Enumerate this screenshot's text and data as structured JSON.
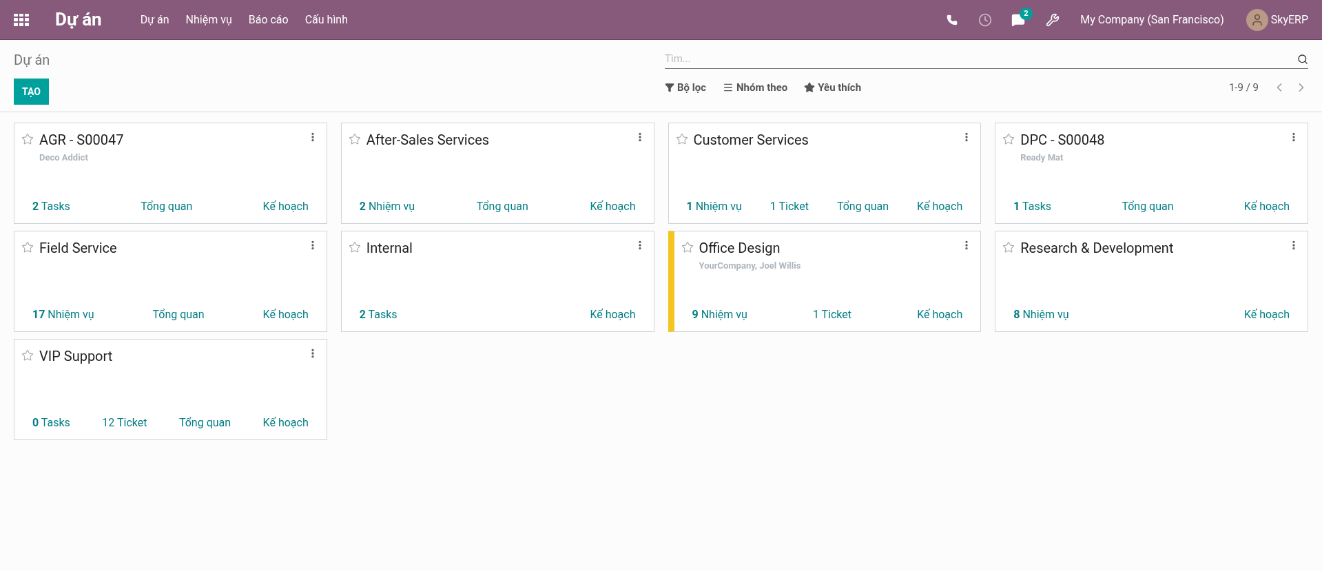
{
  "navbar": {
    "app_title": "Dự án",
    "menu": [
      "Dự án",
      "Nhiệm vụ",
      "Báo cáo",
      "Cấu hình"
    ],
    "message_count": "2",
    "company": "My Company (San Francisco)",
    "user": "SkyERP"
  },
  "control_panel": {
    "breadcrumb": "Dự án",
    "create_button": "TẠO",
    "search": {
      "placeholder": "Tìm..."
    },
    "filters": [
      {
        "kind": "filter",
        "label": "Bộ lọc"
      },
      {
        "kind": "group",
        "label": "Nhóm theo"
      },
      {
        "kind": "favorite",
        "label": "Yêu thích"
      }
    ],
    "pager": "1-9 / 9"
  },
  "projects": [
    {
      "name": "AGR - S00047",
      "subtitle": "Deco Addict",
      "favorite": false,
      "links": [
        "**2** Tasks",
        "Tổng quan",
        "Kế hoạch"
      ]
    },
    {
      "name": "After-Sales Services",
      "favorite": false,
      "links": [
        "**2** Nhiệm vụ",
        "Tổng quan",
        "Kế hoạch"
      ]
    },
    {
      "name": "Customer Services",
      "favorite": false,
      "links": [
        "**1** Nhiệm vụ",
        "1 Ticket",
        "Tổng quan",
        "Kế hoạch"
      ]
    },
    {
      "name": "DPC - S00048",
      "subtitle": "Ready Mat",
      "favorite": false,
      "links": [
        "**1** Tasks",
        "Tổng quan",
        "Kế hoạch"
      ]
    },
    {
      "name": "Field Service",
      "favorite": false,
      "links": [
        "**17** Nhiệm vụ",
        "Tổng quan",
        "Kế hoạch"
      ]
    },
    {
      "name": "Internal",
      "favorite": false,
      "links": [
        "**2** Tasks",
        "Kế hoạch"
      ]
    },
    {
      "name": "Office Design",
      "subtitle": "YourCompany, Joel Willis",
      "favorite": false,
      "color": "#f4c521",
      "links": [
        "**9** Nhiệm vụ",
        "1 Ticket",
        "Kế hoạch"
      ]
    },
    {
      "name": "Research & Development",
      "favorite": false,
      "links": [
        "**8** Nhiệm vụ",
        "Kế hoạch"
      ]
    },
    {
      "name": "VIP Support",
      "favorite": false,
      "links": [
        "**0** Tasks",
        "12 Ticket",
        "Tổng quan",
        "Kế hoạch"
      ]
    }
  ]
}
